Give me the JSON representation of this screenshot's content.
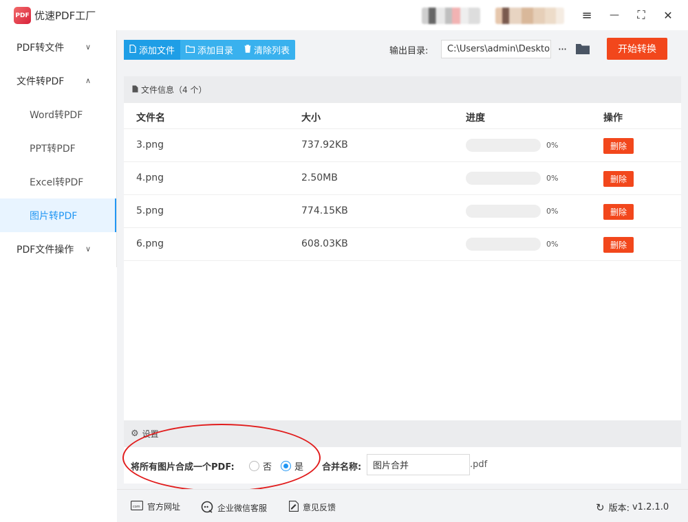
{
  "app": {
    "title": "优速PDF工厂",
    "logo_text": "PDF"
  },
  "window_controls": {
    "menu": "≡",
    "minimize": "—",
    "maximize": "⛶",
    "close": "✕"
  },
  "sidebar": {
    "items": [
      {
        "label": "PDF转文件",
        "expanded": false,
        "chevron": "∨"
      },
      {
        "label": "文件转PDF",
        "expanded": true,
        "chevron": "∧"
      },
      {
        "label": "Word转PDF",
        "sub": true
      },
      {
        "label": "PPT转PDF",
        "sub": true
      },
      {
        "label": "Excel转PDF",
        "sub": true
      },
      {
        "label": "图片转PDF",
        "sub": true,
        "active": true
      },
      {
        "label": "PDF文件操作",
        "expanded": false,
        "chevron": "∨"
      }
    ]
  },
  "toolbar": {
    "add_file": "添加文件",
    "add_dir": "添加目录",
    "clear_list": "清除列表",
    "output_label": "输出目录:",
    "output_path": "C:\\Users\\admin\\Deskto",
    "more": "···",
    "start": "开始转换"
  },
  "files": {
    "header": "文件信息（4 个）",
    "columns": {
      "name": "文件名",
      "size": "大小",
      "progress": "进度",
      "action": "操作"
    },
    "rows": [
      {
        "name": "3.png",
        "size": "737.92KB",
        "progress": "0%",
        "progress_value": 0,
        "delete": "删除"
      },
      {
        "name": "4.png",
        "size": "2.50MB",
        "progress": "0%",
        "progress_value": 0,
        "delete": "删除"
      },
      {
        "name": "5.png",
        "size": "774.15KB",
        "progress": "0%",
        "progress_value": 0,
        "delete": "删除"
      },
      {
        "name": "6.png",
        "size": "608.03KB",
        "progress": "0%",
        "progress_value": 0,
        "delete": "删除"
      }
    ]
  },
  "settings": {
    "header": "设置",
    "merge_label": "将所有图片合成一个PDF:",
    "option_no": "否",
    "option_yes": "是",
    "selected": "是",
    "name_label": "合并名称:",
    "name_value": "图片合并",
    "ext": ".pdf"
  },
  "footer": {
    "website": "官方网址",
    "wechat": "企业微信客服",
    "feedback": "意见反馈",
    "version_label": "版本:",
    "version": "v1.2.1.0"
  },
  "colors": {
    "accent": "#2196f3",
    "danger": "#f2471c",
    "toolbar_blue": "#39b1ee",
    "annotation": "#e11c1c"
  }
}
